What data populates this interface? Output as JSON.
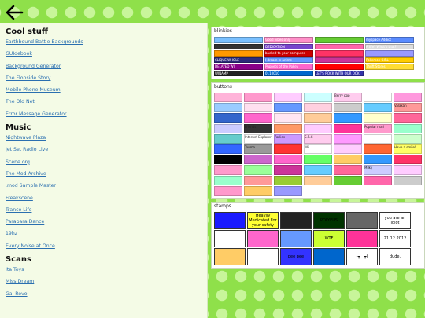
{
  "nav": {
    "back_icon": "arrow-left-icon"
  },
  "sidebar": {
    "sections": [
      {
        "heading": "Cool stuff",
        "links": [
          "Earthbound Battle Backgrounds",
          "GUIdebook",
          "Background Generator",
          "The Flopside Story",
          "Mobile Phone Museum",
          "The Old Net",
          "Error Message Generator"
        ]
      },
      {
        "heading": "Music",
        "links": [
          "Nightwave Plaza",
          "Jet Set Radio Live",
          "Scene.org",
          "The Mod Archive",
          ".mod Sample Master",
          "Freakscene",
          "Trance Life",
          "Parapara Dance",
          "19hz",
          "Every Noise at Once"
        ]
      },
      {
        "heading": "Scans",
        "links": [
          "Ita Toys",
          "Miss Dream",
          "Gal Revo"
        ]
      }
    ]
  },
  "blinkies": {
    "title": "blinkies",
    "items": [
      {
        "text": "",
        "color": "#7ac0ff"
      },
      {
        "text": "Good vibes only",
        "color": "#ff8fc8"
      },
      {
        "text": "",
        "color": "#66cc33"
      },
      {
        "text": "myspace Addict",
        "color": "#5b8cff"
      },
      {
        "text": "",
        "color": "#333333"
      },
      {
        "text": "DEDICATION",
        "color": "#7744cc"
      },
      {
        "text": "",
        "color": "#ff66aa"
      },
      {
        "text": "A life? What's that?",
        "color": "#dddddd"
      },
      {
        "text": "",
        "color": "#ff9900"
      },
      {
        "text": "backed to your computer",
        "color": "#cc0000"
      },
      {
        "text": "",
        "color": "#ff3366"
      },
      {
        "text": "",
        "color": "#9999ff"
      },
      {
        "text": "CLIQUE WHOLE",
        "color": "#2b2b7a"
      },
      {
        "text": "I dream in anime",
        "color": "#6699ff"
      },
      {
        "text": "",
        "color": "#cc3399"
      },
      {
        "text": "Pokemon GIRL",
        "color": "#ffcc00"
      },
      {
        "text": "DELAYED WI",
        "color": "#880088"
      },
      {
        "text": "Puppets of the Pokey",
        "color": "#ff66cc"
      },
      {
        "text": "",
        "color": "#ff0000"
      },
      {
        "text": "Thrift Stores",
        "color": "#ffdd33"
      },
      {
        "text": "WINAMP",
        "color": "#222222"
      },
      {
        "text": "0110010",
        "color": "#0066cc"
      },
      {
        "text": "LET'S ROCK WITH OUR OOK",
        "color": "#3333aa"
      }
    ]
  },
  "buttons": {
    "title": "buttons",
    "items": [
      {
        "text": "",
        "color": "#ffb3d9"
      },
      {
        "text": "",
        "color": "#ff99cc"
      },
      {
        "text": "",
        "color": "#ffccff"
      },
      {
        "text": "",
        "color": "#ccffff"
      },
      {
        "text": "Berry pop",
        "color": "#ffccee"
      },
      {
        "text": "",
        "color": "#ffffff"
      },
      {
        "text": "",
        "color": "#ff99dd"
      },
      {
        "text": "",
        "color": "#99ccff"
      },
      {
        "text": "",
        "color": "#ffe0f0"
      },
      {
        "text": "",
        "color": "#6699ff"
      },
      {
        "text": "",
        "color": "#ffd0e0"
      },
      {
        "text": "",
        "color": "#cccccc"
      },
      {
        "text": "",
        "color": "#66ccff"
      },
      {
        "text": "Valakan",
        "color": "#ff9999"
      },
      {
        "text": "",
        "color": "#3366cc"
      },
      {
        "text": "",
        "color": "#ff66cc"
      },
      {
        "text": "",
        "color": "#ffe6f2"
      },
      {
        "text": "",
        "color": "#ffcc99"
      },
      {
        "text": "",
        "color": "#3399ff"
      },
      {
        "text": "",
        "color": "#ffffcc"
      },
      {
        "text": "",
        "color": "#ff6699"
      },
      {
        "text": "",
        "color": "#ccccff"
      },
      {
        "text": "Friends",
        "color": "#333333"
      },
      {
        "text": "",
        "color": "#ff9966"
      },
      {
        "text": "",
        "color": "#ffccff"
      },
      {
        "text": "",
        "color": "#ff3399"
      },
      {
        "text": "Popular mail",
        "color": "#ff99cc"
      },
      {
        "text": "",
        "color": "#99ffcc"
      },
      {
        "text": "",
        "color": "#66cccc"
      },
      {
        "text": "Internet Explorer",
        "color": "#ffffff"
      },
      {
        "text": "Rollies",
        "color": "#cc99ff"
      },
      {
        "text": "S.R.C",
        "color": "#ffccee"
      },
      {
        "text": "",
        "color": "#ff99ff"
      },
      {
        "text": "",
        "color": "#ffffff"
      },
      {
        "text": "",
        "color": "#ccffcc"
      },
      {
        "text": "",
        "color": "#3366ff"
      },
      {
        "text": "Tauma",
        "color": "#999999"
      },
      {
        "text": "",
        "color": "#ff3333"
      },
      {
        "text": "Wii",
        "color": "#ffffff"
      },
      {
        "text": "",
        "color": "#ffccff"
      },
      {
        "text": "",
        "color": "#ff6633"
      },
      {
        "text": "Have a smile!",
        "color": "#ffff66"
      },
      {
        "text": "",
        "color": "#000000"
      },
      {
        "text": "",
        "color": "#cc66cc"
      },
      {
        "text": "",
        "color": "#ff66cc"
      },
      {
        "text": "",
        "color": "#66ff66"
      },
      {
        "text": "",
        "color": "#ffcc66"
      },
      {
        "text": "",
        "color": "#3399ff"
      },
      {
        "text": "",
        "color": "#ff3366"
      },
      {
        "text": "",
        "color": "#ff99cc"
      },
      {
        "text": "",
        "color": "#99ff99"
      },
      {
        "text": "",
        "color": "#cc3399"
      },
      {
        "text": "",
        "color": "#66ccff"
      },
      {
        "text": "",
        "color": "#ff6699"
      },
      {
        "text": "Milky",
        "color": "#ccccff"
      },
      {
        "text": "",
        "color": "#ffccff"
      },
      {
        "text": "",
        "color": "#99ffcc"
      },
      {
        "text": "",
        "color": "#ff9999"
      },
      {
        "text": "",
        "color": "#99cc33"
      },
      {
        "text": "",
        "color": "#ffcc99"
      },
      {
        "text": "",
        "color": "#66cc33"
      },
      {
        "text": "",
        "color": "#ff66aa"
      },
      {
        "text": "",
        "color": "#cccccc"
      },
      {
        "text": "",
        "color": "#ff99cc"
      },
      {
        "text": "",
        "color": "#ffcc66"
      },
      {
        "text": "",
        "color": "#9999ff"
      }
    ]
  },
  "stamps": {
    "title": "stamps",
    "items": [
      {
        "text": "",
        "color": "#1a1aff"
      },
      {
        "text": "Heavily Medicated For your safety",
        "color": "#ffff33"
      },
      {
        "text": "",
        "color": "#222222"
      },
      {
        "text": "POLYEUS",
        "color": "#003300"
      },
      {
        "text": "",
        "color": "#666666"
      },
      {
        "text": "you are an idiot",
        "color": "#ffffff"
      },
      {
        "text": "",
        "color": "#ffffff"
      },
      {
        "text": "",
        "color": "#ff66cc"
      },
      {
        "text": "",
        "color": "#6699ff"
      },
      {
        "text": "WTF",
        "color": "#ccff33"
      },
      {
        "text": "",
        "color": "#ff3399"
      },
      {
        "text": "21.12.2012",
        "color": "#ffffff"
      },
      {
        "text": "",
        "color": "#ffcc66"
      },
      {
        "text": "",
        "color": "#ffffff"
      },
      {
        "text": "pee pee",
        "color": "#3333ff"
      },
      {
        "text": "",
        "color": "#0066cc"
      },
      {
        "text": "(┳﹏┳)",
        "color": "#ffffff"
      },
      {
        "text": "dude.",
        "color": "#ffffff"
      }
    ]
  }
}
